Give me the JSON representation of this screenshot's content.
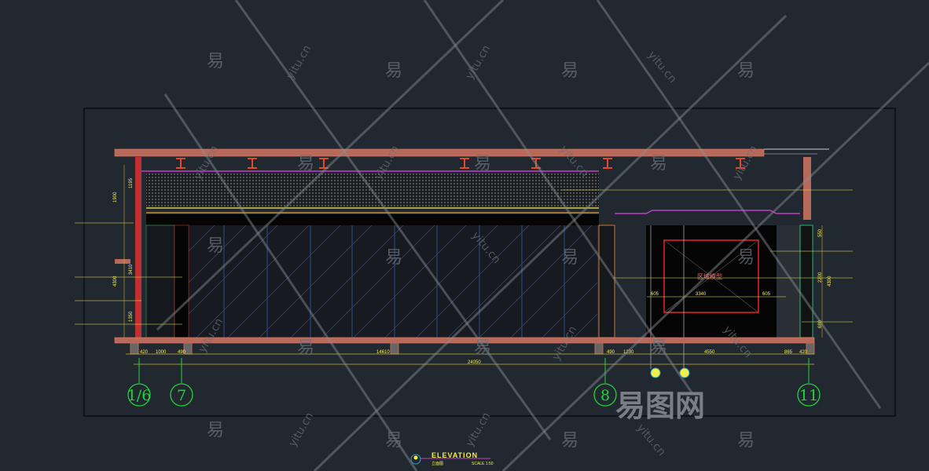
{
  "drawing": {
    "title": "ELEVATION",
    "subtitle": "立面图",
    "scale": "SCALE 1:50",
    "region_label": "区域模型",
    "colors": {
      "background": "#212830",
      "dimension": "#f4f04a",
      "axis": "#22d43a",
      "wall": "#b8695a",
      "ceiling": "#c03fc8",
      "frame": "#e02020"
    }
  },
  "dimensions": {
    "bottom_row": [
      "420",
      "1000",
      "490",
      "14610",
      "490",
      "1230",
      "4550",
      "865",
      "420"
    ],
    "overall": "24050",
    "frame_width": "3340",
    "frame_side_left": "605",
    "frame_side_right": "605",
    "left_vertical": [
      "1900",
      "1195",
      "3410",
      "4300",
      "1350"
    ],
    "right_vertical": [
      "550",
      "2200",
      "4300",
      "680"
    ]
  },
  "axes": [
    "1/6",
    "7",
    "8",
    "11"
  ],
  "watermarks": {
    "char": "易",
    "url": "yitu.cn",
    "logo": "易图网"
  }
}
